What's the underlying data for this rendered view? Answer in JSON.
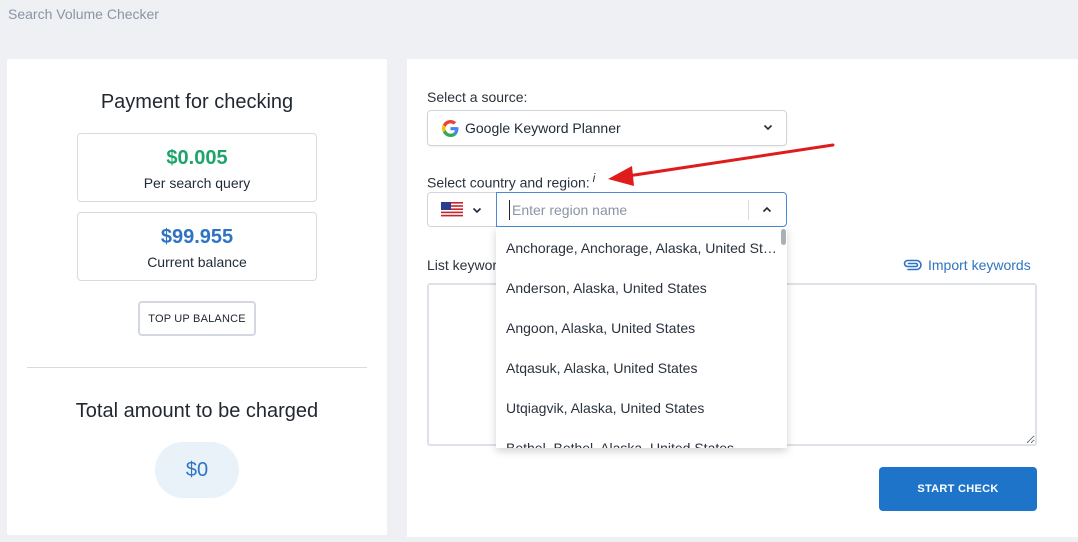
{
  "page": {
    "title": "Search Volume Checker"
  },
  "payment": {
    "heading": "Payment for checking",
    "price": {
      "value": "$0.005",
      "caption": "Per search query"
    },
    "balance": {
      "value": "$99.955",
      "caption": "Current balance"
    },
    "topup_label": "TOP UP BALANCE",
    "total_heading": "Total amount to be charged",
    "total_value": "$0"
  },
  "form": {
    "source_label": "Select a source:",
    "source_value": "Google Keyword Planner",
    "region_label": "Select country and region:",
    "region_info": "i",
    "country_flag": "us-flag",
    "region_placeholder": "Enter region name",
    "keywords_label": "List keywords",
    "import_label": "Import keywords",
    "start_label": "START CHECK"
  },
  "region_options": [
    "Anchorage, Anchorage, Alaska, United States",
    "Anderson, Alaska, United States",
    "Angoon, Alaska, United States",
    "Atqasuk, Alaska, United States",
    "Utqiagvik, Alaska, United States",
    "Bethel, Bethel, Alaska, United States"
  ],
  "colors": {
    "accent": "#1e74c8",
    "price_green": "#1ea36a",
    "balance_blue": "#2f73c4",
    "annotation_red": "#e01b1b"
  },
  "icons": [
    "google-icon",
    "chevron-down-icon",
    "chevron-up-icon",
    "us-flag-icon",
    "paperclip-icon",
    "annotation-arrow-icon"
  ]
}
